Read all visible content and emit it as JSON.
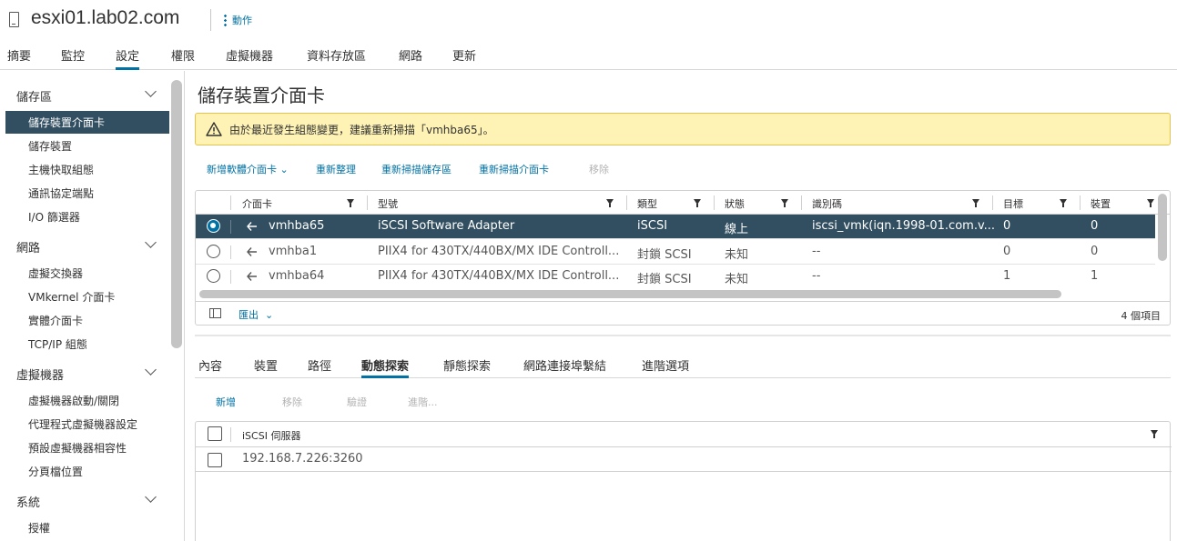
{
  "header": {
    "title": "esxi01.lab02.com",
    "actions_label": "動作"
  },
  "top_tabs": [
    "摘要",
    "監控",
    "設定",
    "權限",
    "虛擬機器",
    "資料存放區",
    "網路",
    "更新"
  ],
  "top_tab_active": "設定",
  "sidebar": {
    "groups": [
      {
        "label": "儲存區",
        "items": [
          "儲存裝置介面卡",
          "儲存裝置",
          "主機快取組態",
          "通訊協定端點",
          "I/O 篩選器"
        ]
      },
      {
        "label": "網路",
        "items": [
          "虛擬交換器",
          "VMkernel 介面卡",
          "實體介面卡",
          "TCP/IP 組態"
        ]
      },
      {
        "label": "虛擬機器",
        "items": [
          "虛擬機器啟動/關閉",
          "代理程式虛擬機器設定",
          "預設虛擬機器相容性",
          "分頁檔位置"
        ]
      },
      {
        "label": "系統",
        "items": [
          "授權"
        ]
      }
    ],
    "active_item": "儲存裝置介面卡"
  },
  "main": {
    "title": "儲存裝置介面卡",
    "alert": "由於最近發生組態變更，建議重新掃描「vmhba65」。",
    "toolbar": {
      "add": "新增軟體介面卡",
      "refresh": "重新整理",
      "rescan_storage": "重新掃描儲存區",
      "rescan_adapter": "重新掃描介面卡",
      "remove": "移除"
    },
    "adapters_table": {
      "columns": [
        "介面卡",
        "型號",
        "類型",
        "狀態",
        "識別碼",
        "目標",
        "裝置"
      ],
      "rows": [
        {
          "adapter": "vmhba65",
          "model": "iSCSI Software Adapter",
          "type": "iSCSI",
          "status": "線上",
          "id": "iscsi_vmk(iqn.1998-01.com.v...",
          "targets": "0",
          "devices": "0",
          "selected": true
        },
        {
          "adapter": "vmhba1",
          "model": "PIIX4 for 430TX/440BX/MX IDE Controll...",
          "type": "封鎖 SCSI",
          "status": "未知",
          "id": "--",
          "targets": "0",
          "devices": "0",
          "selected": false
        },
        {
          "adapter": "vmhba64",
          "model": "PIIX4 for 430TX/440BX/MX IDE Controll...",
          "type": "封鎖 SCSI",
          "status": "未知",
          "id": "--",
          "targets": "1",
          "devices": "1",
          "selected": false
        }
      ],
      "export_label": "匯出",
      "count_label": "4 個項目"
    },
    "sub_tabs": [
      "內容",
      "裝置",
      "路徑",
      "動態探索",
      "靜態探索",
      "網路連接埠繫結",
      "進階選項"
    ],
    "sub_tab_active": "動態探索",
    "bottom_toolbar": {
      "add": "新增",
      "remove": "移除",
      "auth": "驗證",
      "advanced": "進階..."
    },
    "servers_table": {
      "column": "iSCSI 伺服器",
      "rows": [
        "192.168.7.226:3260"
      ]
    }
  },
  "colors": {
    "accent": "#0072a3",
    "selected_row": "#324f61",
    "alert_bg": "#fef3b5",
    "alert_border": "#e6c34d"
  }
}
